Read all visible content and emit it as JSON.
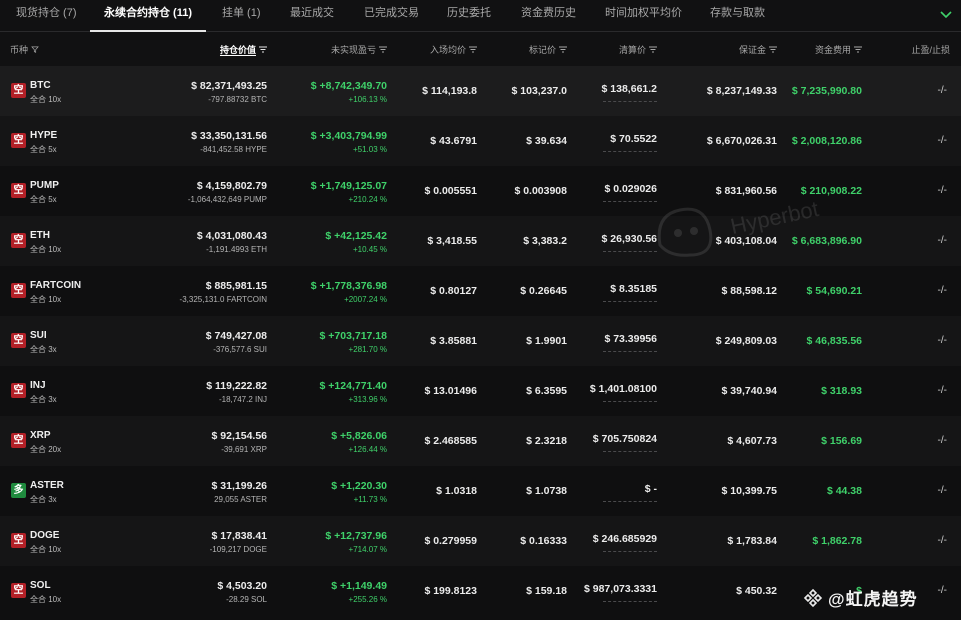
{
  "tabs": [
    {
      "label": "现货持仓 (7)",
      "active": false
    },
    {
      "label": "永续合约持仓 (11)",
      "active": true
    },
    {
      "label": "挂单 (1)",
      "active": false
    },
    {
      "label": "最近成交",
      "active": false
    },
    {
      "label": "已完成交易",
      "active": false
    },
    {
      "label": "历史委托",
      "active": false
    },
    {
      "label": "资金费历史",
      "active": false
    },
    {
      "label": "时间加权平均价",
      "active": false
    },
    {
      "label": "存款与取款",
      "active": false
    }
  ],
  "columns": {
    "coin": "币种",
    "position_value": "持仓价值",
    "unrealized_pnl": "未实现盈亏",
    "entry_price": "入场均价",
    "mark_price": "标记价",
    "liq_price": "清算价",
    "margin": "保证金",
    "funding": "资金费用",
    "tp_sl": "止盈/止损"
  },
  "rows": [
    {
      "coin": "BTC",
      "side": "空",
      "side_type": "short",
      "mode": "全合 10x",
      "value": "$ 82,371,493.25",
      "size": "-797.88732 BTC",
      "pnl": "$ +8,742,349.70",
      "pnl_pct": "+106.13 %",
      "entry": "$ 114,193.8",
      "mark": "$ 103,237.0",
      "liq": "$ 138,661.2",
      "margin": "$ 8,237,149.33",
      "funding": "$ 7,235,990.80",
      "tpsl": "-/-"
    },
    {
      "coin": "HYPE",
      "side": "空",
      "side_type": "short",
      "mode": "全合 5x",
      "value": "$ 33,350,131.56",
      "size": "-841,452.58 HYPE",
      "pnl": "$ +3,403,794.99",
      "pnl_pct": "+51.03 %",
      "entry": "$ 43.6791",
      "mark": "$ 39.634",
      "liq": "$ 70.5522",
      "margin": "$ 6,670,026.31",
      "funding": "$ 2,008,120.86",
      "tpsl": "-/-"
    },
    {
      "coin": "PUMP",
      "side": "空",
      "side_type": "short",
      "mode": "全合 5x",
      "value": "$ 4,159,802.79",
      "size": "-1,064,432,649 PUMP",
      "pnl": "$ +1,749,125.07",
      "pnl_pct": "+210.24 %",
      "entry": "$ 0.005551",
      "mark": "$ 0.003908",
      "liq": "$ 0.029026",
      "margin": "$ 831,960.56",
      "funding": "$ 210,908.22",
      "tpsl": "-/-"
    },
    {
      "coin": "ETH",
      "side": "空",
      "side_type": "short",
      "mode": "全合 10x",
      "value": "$ 4,031,080.43",
      "size": "-1,191.4993 ETH",
      "pnl": "$ +42,125.42",
      "pnl_pct": "+10.45 %",
      "entry": "$ 3,418.55",
      "mark": "$ 3,383.2",
      "liq": "$ 26,930.56",
      "margin": "$ 403,108.04",
      "funding": "$ 6,683,896.90",
      "tpsl": "-/-"
    },
    {
      "coin": "FARTCOIN",
      "side": "空",
      "side_type": "short",
      "mode": "全合 10x",
      "value": "$ 885,981.15",
      "size": "-3,325,131.0 FARTCOIN",
      "pnl": "$ +1,778,376.98",
      "pnl_pct": "+2007.24 %",
      "entry": "$ 0.80127",
      "mark": "$ 0.26645",
      "liq": "$ 8.35185",
      "margin": "$ 88,598.12",
      "funding": "$ 54,690.21",
      "tpsl": "-/-"
    },
    {
      "coin": "SUI",
      "side": "空",
      "side_type": "short",
      "mode": "全合 3x",
      "value": "$ 749,427.08",
      "size": "-376,577.6 SUI",
      "pnl": "$ +703,717.18",
      "pnl_pct": "+281.70 %",
      "entry": "$ 3.85881",
      "mark": "$ 1.9901",
      "liq": "$ 73.39956",
      "margin": "$ 249,809.03",
      "funding": "$ 46,835.56",
      "tpsl": "-/-"
    },
    {
      "coin": "INJ",
      "side": "空",
      "side_type": "short",
      "mode": "全合 3x",
      "value": "$ 119,222.82",
      "size": "-18,747.2 INJ",
      "pnl": "$ +124,771.40",
      "pnl_pct": "+313.96 %",
      "entry": "$ 13.01496",
      "mark": "$ 6.3595",
      "liq": "$ 1,401.08100",
      "margin": "$ 39,740.94",
      "funding": "$ 318.93",
      "tpsl": "-/-"
    },
    {
      "coin": "XRP",
      "side": "空",
      "side_type": "short",
      "mode": "全合 20x",
      "value": "$ 92,154.56",
      "size": "-39,691 XRP",
      "pnl": "$ +5,826.06",
      "pnl_pct": "+126.44 %",
      "entry": "$ 2.468585",
      "mark": "$ 2.3218",
      "liq": "$ 705.750824",
      "margin": "$ 4,607.73",
      "funding": "$ 156.69",
      "tpsl": "-/-"
    },
    {
      "coin": "ASTER",
      "side": "多",
      "side_type": "long",
      "mode": "全合 3x",
      "value": "$ 31,199.26",
      "size": "29,055 ASTER",
      "pnl": "$ +1,220.30",
      "pnl_pct": "+11.73 %",
      "entry": "$ 1.0318",
      "mark": "$ 1.0738",
      "liq": "$ -",
      "margin": "$ 10,399.75",
      "funding": "$ 44.38",
      "tpsl": "-/-"
    },
    {
      "coin": "DOGE",
      "side": "空",
      "side_type": "short",
      "mode": "全合 10x",
      "value": "$ 17,838.41",
      "size": "-109,217 DOGE",
      "pnl": "$ +12,737.96",
      "pnl_pct": "+714.07 %",
      "entry": "$ 0.279959",
      "mark": "$ 0.16333",
      "liq": "$ 246.685929",
      "margin": "$ 1,783.84",
      "funding": "$ 1,862.78",
      "tpsl": "-/-"
    },
    {
      "coin": "SOL",
      "side": "空",
      "side_type": "short",
      "mode": "全合 10x",
      "value": "$ 4,503.20",
      "size": "-28.29 SOL",
      "pnl": "$ +1,149.49",
      "pnl_pct": "+255.26 %",
      "entry": "$ 199.8123",
      "mark": "$ 159.18",
      "liq": "$ 987,073.3331",
      "margin": "$ 450.32",
      "funding": "$",
      "tpsl": "-/-"
    }
  ],
  "watermark": "Hyperbot",
  "brand": "@虹虎趋势",
  "colors": {
    "positive": "#3fd16a",
    "short_badge": "#b32027",
    "long_badge": "#1f8b3e",
    "background": "#0f0f10"
  }
}
